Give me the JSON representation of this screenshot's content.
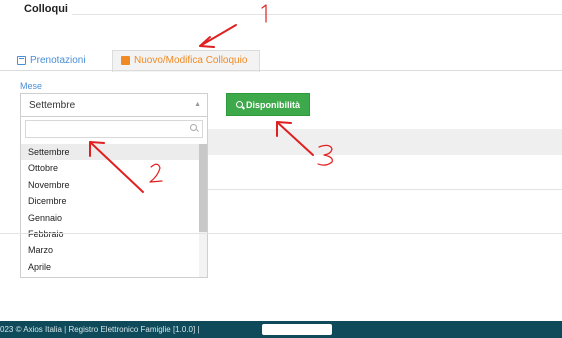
{
  "section": {
    "title": "Colloqui"
  },
  "tabs": [
    {
      "label": "Prenotazioni",
      "icon": "calendar-icon",
      "color": "#4a8fd6"
    },
    {
      "label": "Nuovo/Modifica Colloquio",
      "icon": "calendar-plus-icon",
      "color": "#f08a24"
    }
  ],
  "form": {
    "month_label": "Mese",
    "selected_month": "Settembre",
    "search_value": "",
    "options": [
      "Settembre",
      "Ottobre",
      "Novembre",
      "Dicembre",
      "Gennaio",
      "Febbraio",
      "Marzo",
      "Aprile"
    ],
    "button_label": "Disponibilità",
    "button_color": "#3ea94a"
  },
  "footer": {
    "text": "023 © Axios Italia |   Registro Elettronico Famiglie [1.0.0] |",
    "background": "#0e4a5a"
  },
  "annotations": {
    "color": "#e02020",
    "numbers": [
      "1",
      "2",
      "3"
    ]
  }
}
